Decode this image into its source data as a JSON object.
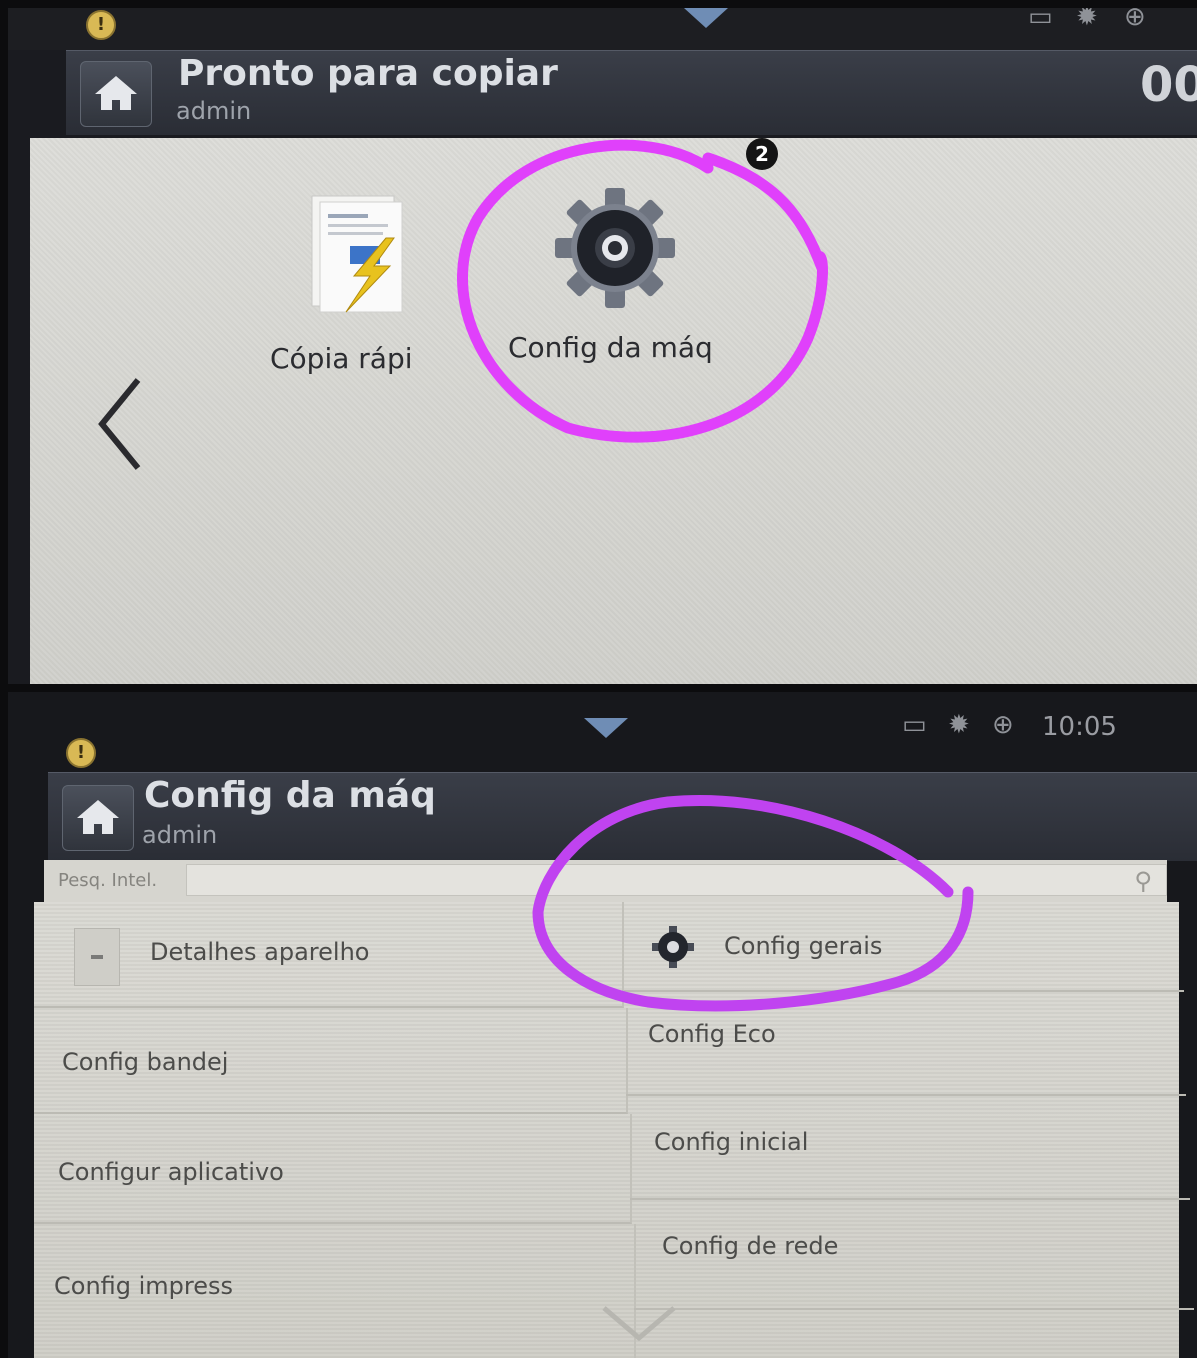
{
  "colors": {
    "highlight": "#e040fb",
    "header_bg": "#2e3139",
    "content_bg": "#d6d6d1",
    "accent_arrow": "#6f8db5"
  },
  "screen1": {
    "status": {
      "warning_icon": "warning-icon",
      "pull_down_icon": "chevron-down-icon"
    },
    "header": {
      "title": "Pronto para copiar",
      "user": "admin",
      "counter": "00",
      "home_icon": "home-icon"
    },
    "apps": [
      {
        "label": "Cópia rápi",
        "icon": "quick-copy-icon"
      },
      {
        "label": "Config da máq",
        "icon": "gear-icon"
      }
    ],
    "nav": {
      "back_icon": "chevron-left-icon"
    },
    "badge": "2"
  },
  "screen2": {
    "status": {
      "clock": "10:05",
      "icons": [
        "tray-icon",
        "eco-sun-icon",
        "globe-icon"
      ]
    },
    "header": {
      "title": "Config da máq",
      "user": "admin",
      "home_icon": "home-icon"
    },
    "search": {
      "label": "Pesq. Intel.",
      "value": "",
      "icon": "search-icon"
    },
    "menu": {
      "left": [
        "Detalhes aparelho",
        "Config bandej",
        "Configur aplicativo",
        "Config impress"
      ],
      "right": [
        "Config gerais",
        "Config Eco",
        "Config inicial",
        "Config de rede"
      ]
    },
    "scroll_icon": "chevron-down-icon"
  }
}
